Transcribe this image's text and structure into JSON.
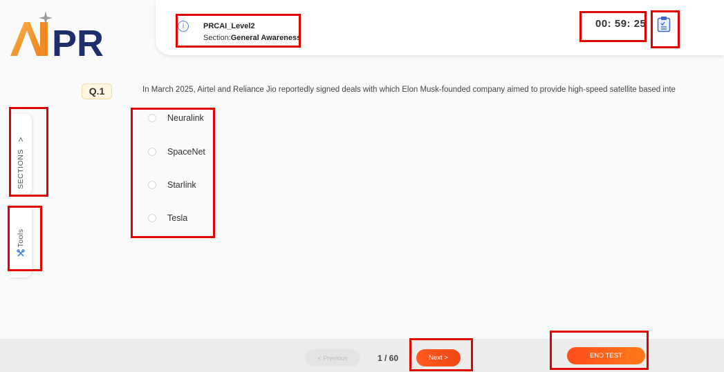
{
  "logo": {
    "text": "AIPR",
    "icon": "sparkle-icon"
  },
  "header": {
    "info_icon": "i",
    "test_name": "PRCAI_Level2",
    "section_label": "Section:",
    "section_name": "General Awareness",
    "timer": "00: 59: 25",
    "summary_icon": "clipboard-icon"
  },
  "question": {
    "number": "Q.1",
    "text": "In March 2025, Airtel and Reliance Jio reportedly signed deals with which Elon Musk-founded company aimed to provide high-speed satellite based inte",
    "options": [
      "Neuralink",
      "SpaceNet",
      "Starlink",
      "Tesla"
    ]
  },
  "sidebar": {
    "sections_label": "SECTIONS",
    "sections_chevron": ">",
    "tools_label": "Tools"
  },
  "footer": {
    "previous_label": "< Previous",
    "page_count": "1 / 60",
    "next_label": "Next  >",
    "end_test_label": "END TEST"
  },
  "colors": {
    "accent_orange": "#f04814",
    "logo_orange": "#f39a2e",
    "logo_blue": "#1d2f6b",
    "highlight_red": "#e00000"
  }
}
